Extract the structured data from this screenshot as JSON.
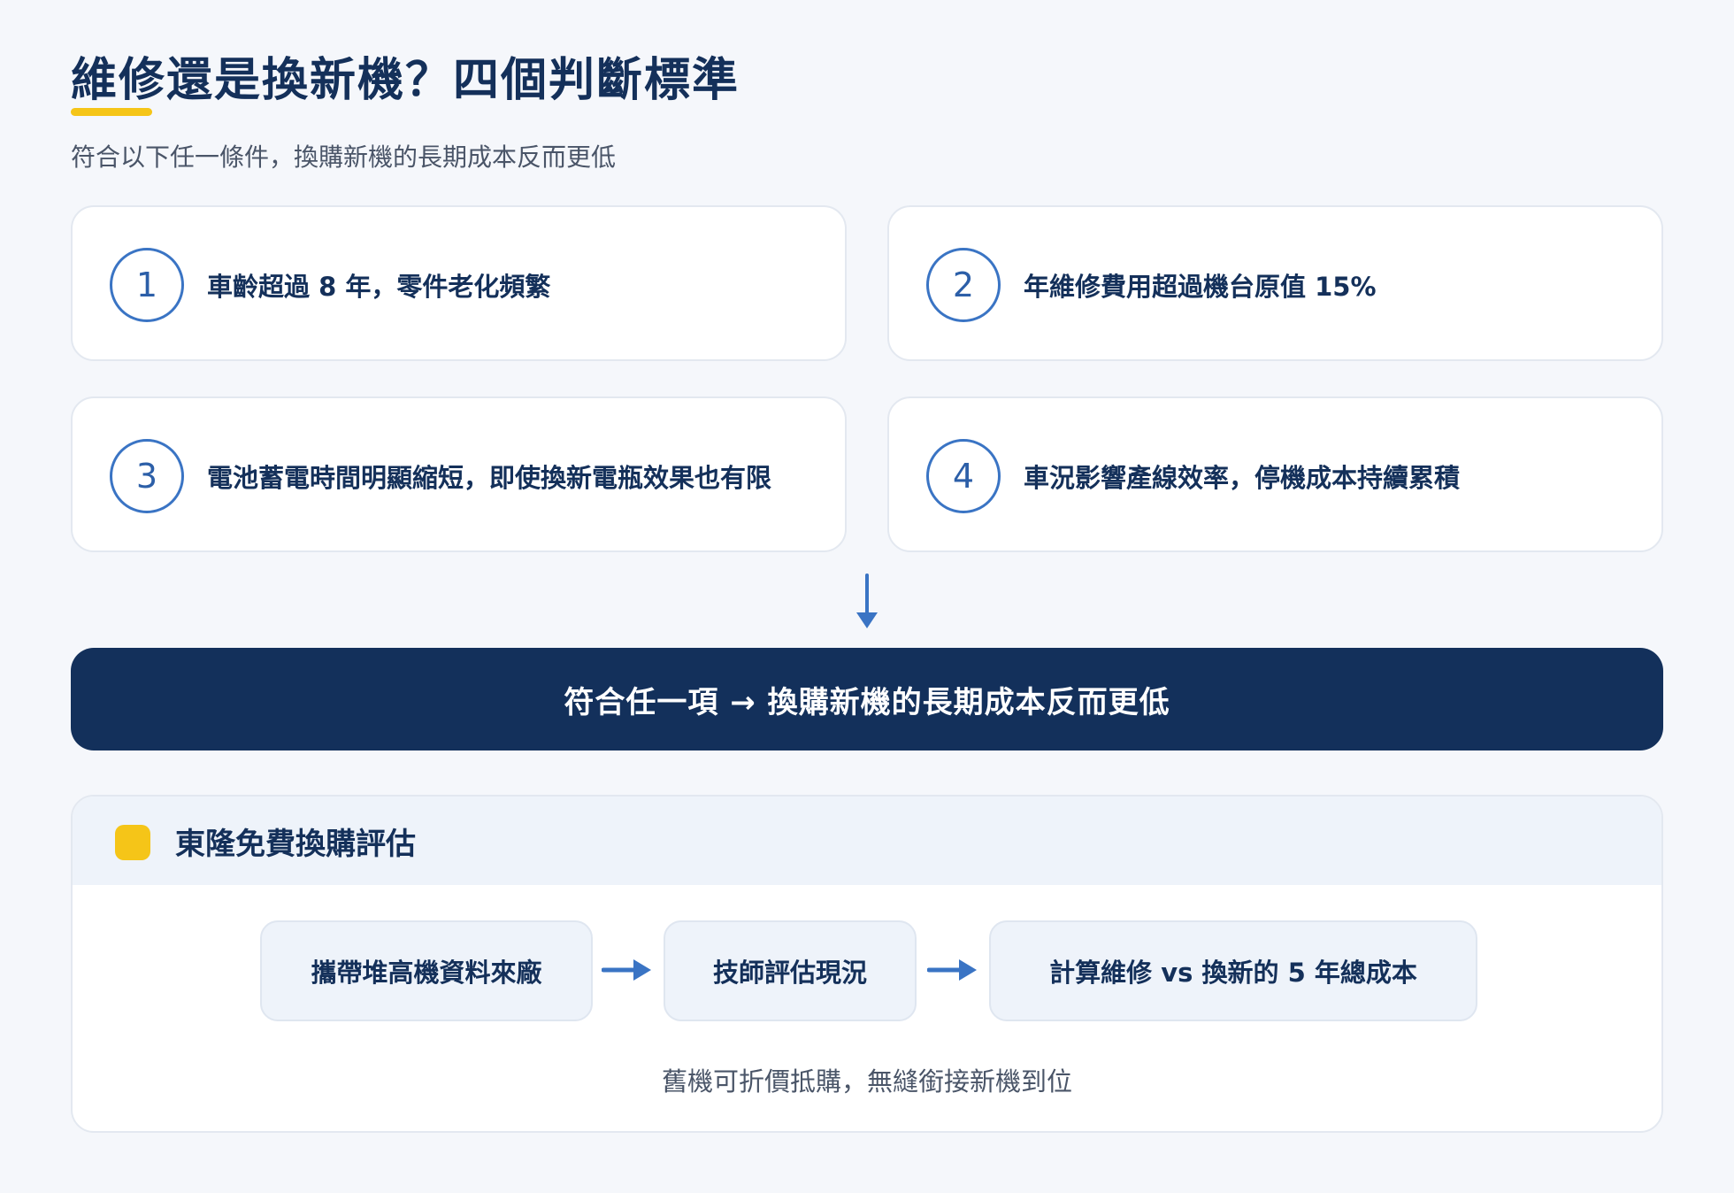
{
  "header": {
    "title": "維修還是換新機？四個判斷標準",
    "subtitle": "符合以下任一條件，換購新機的長期成本反而更低"
  },
  "criteria": [
    {
      "number": "1",
      "text": "車齡超過 8 年，零件老化頻繁"
    },
    {
      "number": "2",
      "text": "年維修費用超過機台原值 15%"
    },
    {
      "number": "3",
      "text": "電池蓄電時間明顯縮短，即使換新電瓶效果也有限"
    },
    {
      "number": "4",
      "text": "車況影響產線效率，停機成本持續累積"
    }
  ],
  "banner": {
    "text": "符合任一項 → 換購新機的長期成本反而更低"
  },
  "evaluation": {
    "title": "東隆免費換購評估",
    "steps": [
      "攜帶堆高機資料來廠",
      "技師評估現況",
      "計算維修 vs 換新的 5 年總成本"
    ],
    "note": "舊機可折價抵購，無縫銜接新機到位"
  },
  "colors": {
    "navy": "#13305b",
    "accent_yellow": "#f5c518",
    "accent_blue": "#3a74c4"
  }
}
